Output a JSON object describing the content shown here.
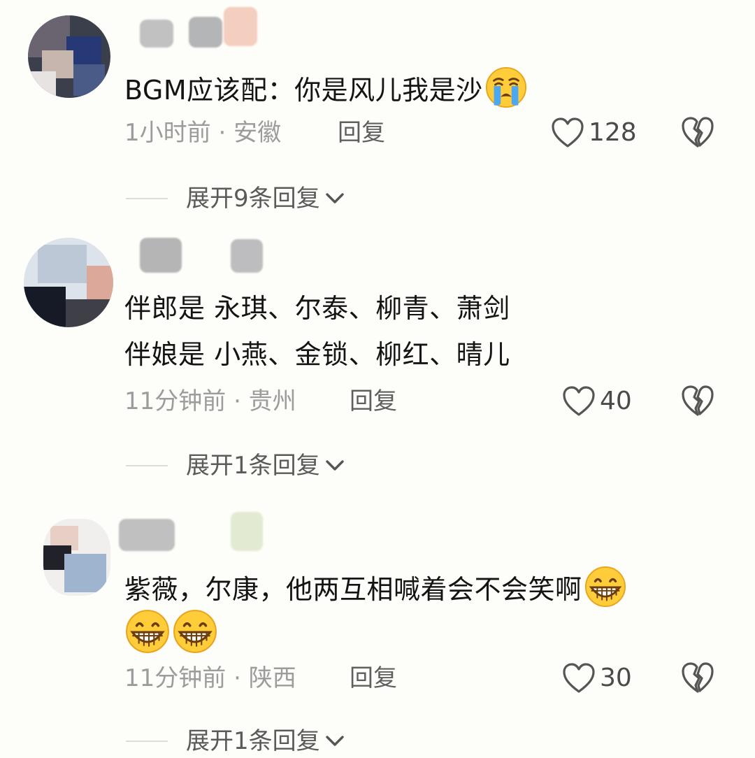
{
  "comments": [
    {
      "text_lines": [
        "BGM应该配：你是风儿我是沙"
      ],
      "trailing_emoji": "crying-face",
      "time": "1小时前",
      "separator": "·",
      "location": "安徽",
      "reply_label": "回复",
      "like_count": "128",
      "expand_label": "展开9条回复"
    },
    {
      "text_lines": [
        "伴郎是 永琪、尔泰、柳青、萧剑",
        "伴娘是 小燕、金锁、柳红、晴儿"
      ],
      "time": "11分钟前",
      "separator": "·",
      "location": "贵州",
      "reply_label": "回复",
      "like_count": "40",
      "expand_label": "展开1条回复"
    },
    {
      "text_lines": [
        "紫薇，尔康，他两互相喊着会不会笑啊"
      ],
      "trailing_emoji": "grinning-face",
      "extra_emojis": [
        "grinning-face",
        "grinning-face"
      ],
      "time": "11分钟前",
      "separator": "·",
      "location": "陕西",
      "reply_label": "回复",
      "like_count": "30",
      "expand_label": "展开1条回复"
    }
  ],
  "icons": {
    "like": "heart-outline-icon",
    "dislike": "broken-heart-icon",
    "expand": "chevron-down-icon"
  },
  "colors": {
    "background": "#fdfdf9",
    "text": "#141414",
    "meta": "#9c9c9c",
    "icon": "#555555"
  }
}
